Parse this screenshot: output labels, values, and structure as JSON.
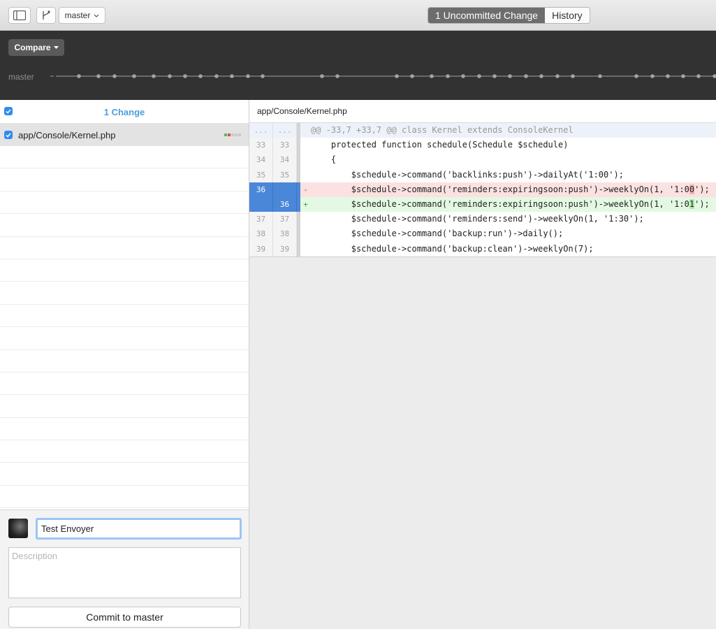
{
  "toolbar": {
    "branch_label": "master",
    "tabs": [
      {
        "label": "1 Uncommitted Change"
      },
      {
        "label": "History"
      }
    ]
  },
  "timeline": {
    "compare_label": "Compare",
    "branch_label": "master"
  },
  "sidebar": {
    "header_title": "1 Change",
    "files": [
      {
        "path": "app/Console/Kernel.php"
      }
    ]
  },
  "commit": {
    "summary": "Test Envoyer",
    "description_placeholder": "Description",
    "button_label": "Commit to master"
  },
  "diff": {
    "file_path": "app/Console/Kernel.php",
    "hunk": {
      "old": "...",
      "new": "...",
      "text": "@@ -33,7 +33,7 @@ class Kernel extends ConsoleKernel"
    },
    "lines": [
      {
        "old": "33",
        "new": "33",
        "sign": "",
        "code": "    protected function schedule(Schedule $schedule)"
      },
      {
        "old": "34",
        "new": "34",
        "sign": "",
        "code": "    {"
      },
      {
        "old": "35",
        "new": "35",
        "sign": "",
        "code": "        $schedule->command('backlinks:push')->dailyAt('1:00');"
      },
      {
        "old": "36",
        "new": "",
        "sign": "-",
        "code_a": "        $schedule->command('reminders:expiringsoon:push')->weeklyOn(1, '1:0",
        "code_hl": "0",
        "code_b": "');"
      },
      {
        "old": "",
        "new": "36",
        "sign": "+",
        "code_a": "        $schedule->command('reminders:expiringsoon:push')->weeklyOn(1, '1:0",
        "code_hl": "1",
        "code_b": "');"
      },
      {
        "old": "37",
        "new": "37",
        "sign": "",
        "code": "        $schedule->command('reminders:send')->weeklyOn(1, '1:30');"
      },
      {
        "old": "38",
        "new": "38",
        "sign": "",
        "code": "        $schedule->command('backup:run')->daily();"
      },
      {
        "old": "39",
        "new": "39",
        "sign": "",
        "code": "        $schedule->command('backup:clean')->weeklyOn(7);"
      }
    ]
  },
  "colors": {
    "accent": "#4a9ee0",
    "selection": "#4b87d8",
    "deleted_bg": "#fbe1e1",
    "added_bg": "#e3f9e3"
  }
}
